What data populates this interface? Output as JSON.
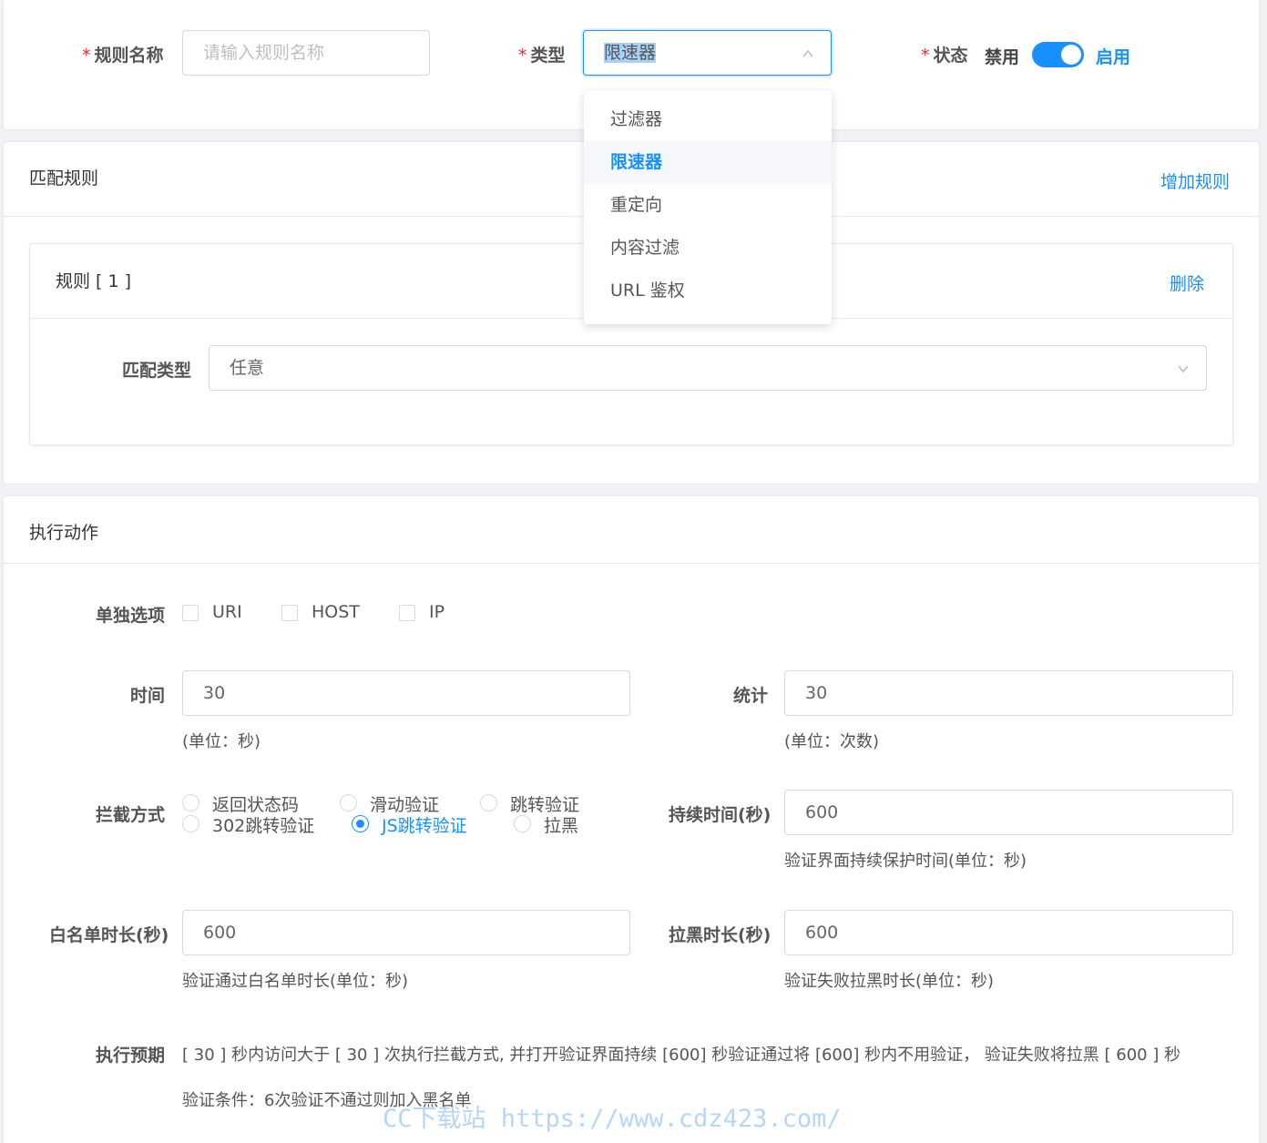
{
  "top_form": {
    "rule_name": {
      "required_mark": "*",
      "label": "规则名称",
      "placeholder": "请输入规则名称"
    },
    "type": {
      "required_mark": "*",
      "label": "类型",
      "value": "限速器"
    },
    "status": {
      "required_mark": "*",
      "label": "状态",
      "off_label": "禁用",
      "on_label": "启用",
      "enabled": true
    },
    "type_options": [
      "过滤器",
      "限速器",
      "重定向",
      "内容过滤",
      "URL 鉴权"
    ],
    "type_selected_index": 1
  },
  "match_rules": {
    "title": "匹配规则",
    "add_rule": "增加规则",
    "rule": {
      "title": "规则 [ 1 ]",
      "delete": "删除",
      "match_type_label": "匹配类型",
      "match_type_value": "任意"
    }
  },
  "action": {
    "title": "执行动作",
    "single_options": {
      "label": "单独选项",
      "items": [
        "URI",
        "HOST",
        "IP"
      ]
    },
    "time": {
      "label": "时间",
      "value": "30",
      "hint": "(单位：秒)"
    },
    "count": {
      "label": "统计",
      "value": "30",
      "hint": "(单位：次数)"
    },
    "block_mode": {
      "label": "拦截方式",
      "options": [
        "返回状态码",
        "滑动验证",
        "跳转验证",
        "302跳转验证",
        "JS跳转验证",
        "拉黑"
      ],
      "selected": "JS跳转验证"
    },
    "duration": {
      "label": "持续时间(秒)",
      "value": "600",
      "hint": "验证界面持续保护时间(单位：秒)"
    },
    "whitelist": {
      "label": "白名单时长(秒)",
      "value": "600",
      "hint": "验证通过白名单时长(单位：秒)"
    },
    "blacklist": {
      "label": "拉黑时长(秒)",
      "value": "600",
      "hint": "验证失败拉黑时长(单位：秒)"
    },
    "expected": {
      "label": "执行预期",
      "text": "[ 30 ] 秒内访问大于 [ 30 ] 次执行拦截方式, 并打开验证界面持续 [600] 秒验证通过将 [600] 秒内不用验证，  验证失败将拉黑 [ 600 ] 秒",
      "condition": "验证条件：6次验证不通过则加入黑名单"
    }
  },
  "watermark": "CC下载站 https://www.cdz423.com/",
  "colors": {
    "primary": "#1890ff",
    "required": "#f5222d"
  }
}
